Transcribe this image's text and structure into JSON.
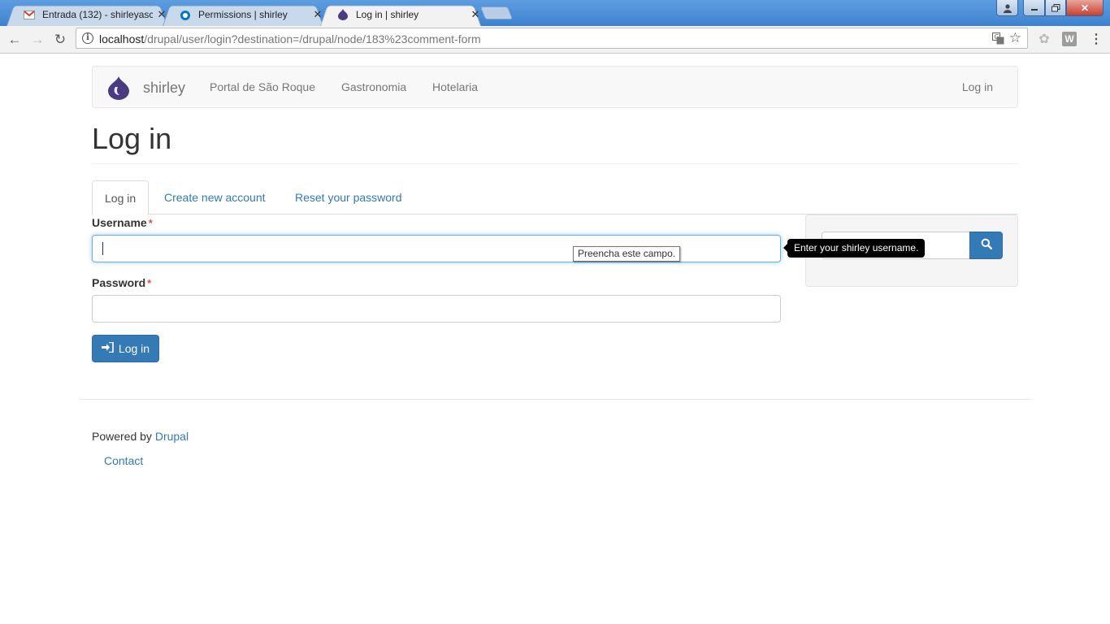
{
  "browser": {
    "tabs": [
      {
        "title": "Entrada (132) - shirleyasc",
        "icon": "gmail-icon",
        "active": false
      },
      {
        "title": "Permissions | shirley",
        "icon": "drupal-icon",
        "active": false
      },
      {
        "title": "Log in | shirley",
        "icon": "drupal-icon",
        "active": true
      }
    ],
    "url_host": "localhost",
    "url_path": "/drupal/user/login?destination=/drupal/node/183%23comment-form",
    "extension_label": "W"
  },
  "site": {
    "brand": "shirley",
    "nav": [
      "Portal de São Roque",
      "Gastronomia",
      "Hotelaria"
    ],
    "login_link": "Log in",
    "accent": "#337ab7"
  },
  "page": {
    "title": "Log in",
    "tabs": [
      "Log in",
      "Create new account",
      "Reset your password"
    ],
    "username_label": "Username",
    "password_label": "Password",
    "required_mark": "*",
    "validation_message": "Preencha este campo.",
    "username_tooltip": "Enter your shirley username.",
    "submit_label": "Log in"
  },
  "footer": {
    "powered_by": "Powered by",
    "drupal_link": "Drupal",
    "contact": "Contact"
  }
}
